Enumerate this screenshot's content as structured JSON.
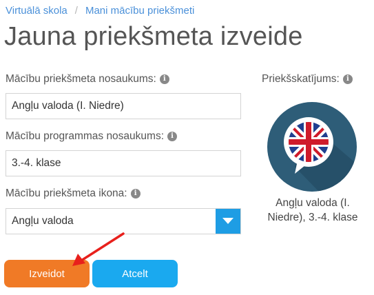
{
  "breadcrumb": {
    "items": [
      {
        "label": "Virtuālā skola"
      },
      {
        "label": "Mani mācību priekšmeti"
      }
    ],
    "separator": "/"
  },
  "page": {
    "title": "Jauna priekšmeta izveide"
  },
  "form": {
    "subject_name": {
      "label": "Mācību priekšmeta nosaukums:",
      "value": "Angļu valoda (I. Niedre)"
    },
    "program_name": {
      "label": "Mācību programmas nosaukums:",
      "value": "3.-4. klase"
    },
    "subject_icon": {
      "label": "Mācību priekšmeta ikona:",
      "selected": "Angļu valoda"
    }
  },
  "preview": {
    "label": "Priekšskatījums:",
    "caption": "Angļu valoda (I. Niedre), 3.-4. klase",
    "icon": "uk-flag-speech-bubble-icon"
  },
  "buttons": {
    "create_label": "Izveidot",
    "cancel_label": "Atcelt"
  },
  "info_glyph": "i",
  "colors": {
    "link": "#4a90d9",
    "create": "#f07a26",
    "cancel": "#1aa9ef",
    "select_arrow": "#1e9de4",
    "preview_bg": "#2e5d78",
    "annotation_arrow": "#e8201c"
  }
}
